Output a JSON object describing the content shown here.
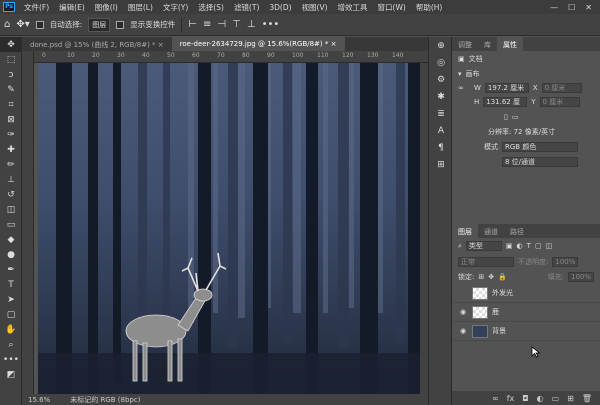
{
  "app": {
    "logo": "Ps",
    "menu": [
      "文件(F)",
      "编辑(E)",
      "图像(I)",
      "图层(L)",
      "文字(Y)",
      "选择(S)",
      "滤镜(T)",
      "3D(D)",
      "视图(V)",
      "增效工具",
      "窗口(W)",
      "帮助(H)"
    ],
    "window_controls": [
      "—",
      "☐",
      "✕"
    ]
  },
  "options": {
    "auto_select_label": "自动选择:",
    "auto_select_value": "图层",
    "transform_label": "显示变换控件",
    "more": "•••"
  },
  "doc_tabs": [
    {
      "label": "done.psd @ 15% (曲线 2, RGB/8#) *",
      "close": "×"
    },
    {
      "label": "roe-deer-2634729.jpg @ 15.6%(RGB/8#) *",
      "close": "×"
    }
  ],
  "ruler": {
    "ticks": [
      "0",
      "10",
      "20",
      "30",
      "40",
      "50",
      "60",
      "70",
      "80",
      "90",
      "100",
      "110",
      "120",
      "130",
      "140"
    ]
  },
  "status": {
    "zoom": "15.6%",
    "profile": "未标记的 RGB (8bpc)"
  },
  "properties": {
    "tabs": [
      "调整",
      "库",
      "属性"
    ],
    "doc_label": "文档",
    "section_canvas": "画布",
    "w_label": "W",
    "w_value": "197.2 厘米",
    "x_label": "X",
    "x_value": "0 厘米",
    "h_label": "H",
    "h_value": "131.62 厘",
    "y_label": "Y",
    "y_value": "0 厘米",
    "resolution": "分辨率: 72 像素/英寸",
    "mode_label": "模式",
    "mode_value": "RGB 颜色",
    "depth_value": "8 位/通道"
  },
  "layers": {
    "tabs": [
      "图层",
      "通道",
      "路径"
    ],
    "kind_label": "类型",
    "blend_mode": "正常",
    "opacity_label": "不透明度:",
    "opacity_value": "100%",
    "lock_label": "锁定:",
    "fill_label": "填充:",
    "fill_value": "100%",
    "items": [
      {
        "name": "外发光",
        "visible": false
      },
      {
        "name": "鹿",
        "visible": true
      },
      {
        "name": "背景",
        "visible": true
      }
    ]
  }
}
